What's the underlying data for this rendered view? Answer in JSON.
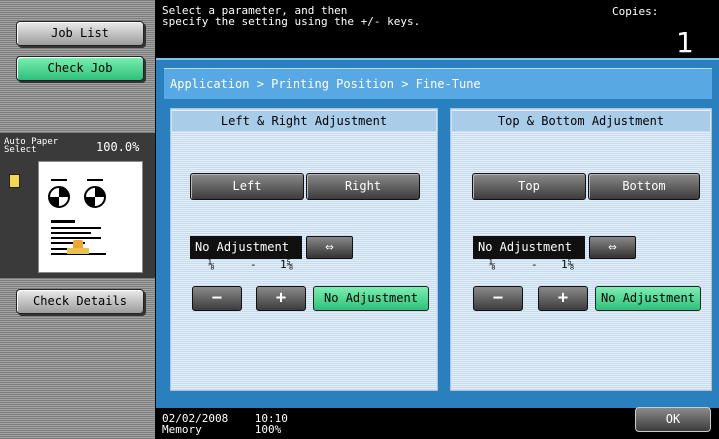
{
  "sidebar": {
    "job_list": "Job List",
    "check_job": "Check Job",
    "paper_label": "Auto Paper Select",
    "zoom": "100.0%",
    "check_details": "Check Details"
  },
  "header": {
    "message_line1": "Select a parameter, and then",
    "message_line2": "specify the setting using the +/- keys.",
    "copies_label": "Copies:",
    "copies_value": "1"
  },
  "breadcrumb": "Application > Printing Position > Fine-Tune",
  "left_right": {
    "title": "Left & Right Adjustment",
    "btn_left": "Left",
    "btn_right": "Right",
    "value": "No Adjustment",
    "swap": "⇔",
    "range_min": "⅛",
    "range_sep": "-",
    "range_max": "1⅝",
    "minus": "−",
    "plus": "+",
    "no_adjustment": "No Adjustment"
  },
  "top_bottom": {
    "title": "Top & Bottom Adjustment",
    "btn_top": "Top",
    "btn_bottom": "Bottom",
    "value": "No Adjustment",
    "swap": "⇔",
    "range_min": "⅛",
    "range_sep": "-",
    "range_max": "1⅝",
    "minus": "−",
    "plus": "+",
    "no_adjustment": "No Adjustment"
  },
  "footer": {
    "date": "02/02/2008",
    "time": "10:10",
    "memory_label": "Memory",
    "memory_value": "100%",
    "ok": "OK"
  },
  "colors": {
    "panel": "#2a7fbf",
    "accent_green": "#2fc07a"
  }
}
